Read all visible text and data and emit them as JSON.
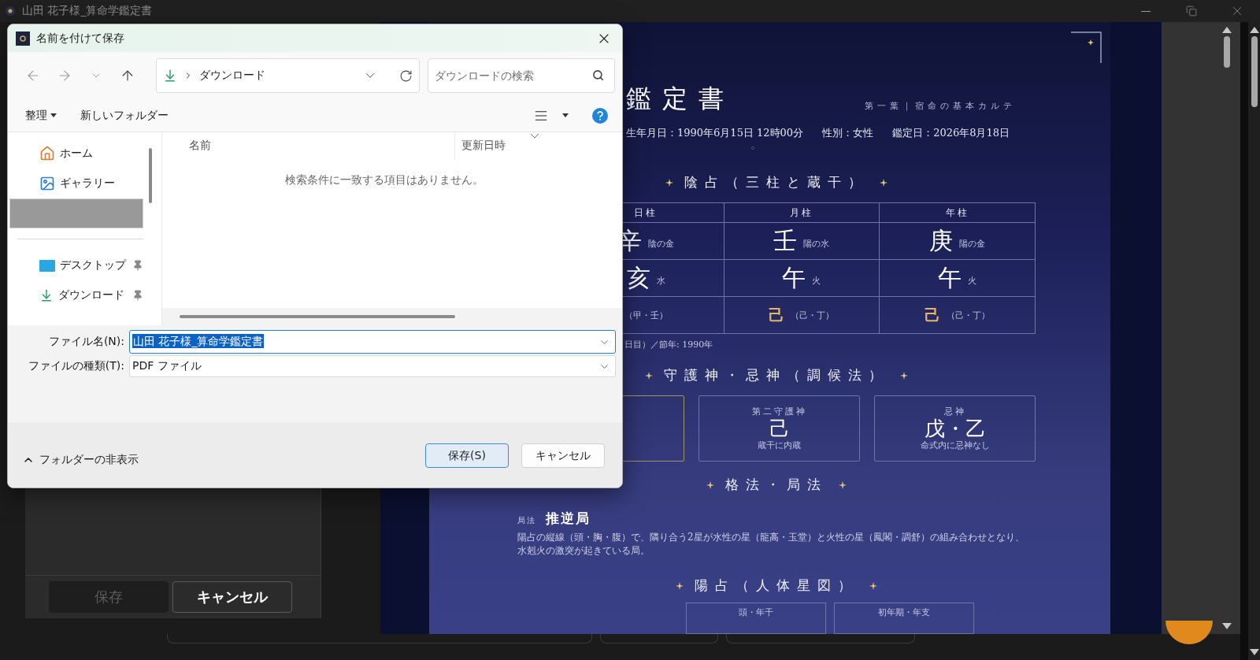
{
  "app": {
    "title": "山田 花子様_算命学鑑定書",
    "panel_buttons": [
      {
        "label": "保存",
        "disabled": true
      },
      {
        "label": "キャンセル",
        "disabled": false
      }
    ]
  },
  "document": {
    "header": {
      "title": "鑑定書",
      "subtitle": "第一葉｜宿命の基本カルテ",
      "info": [
        "生年月日：1990年6月15日 12時00分",
        "性別：女性",
        "鑑定日：2026年8月18日"
      ]
    },
    "insen": {
      "heading": "陰占（三柱と蔵干）",
      "columns": [
        "日柱",
        "月柱",
        "年柱"
      ],
      "rows": [
        {
          "kind": "stem",
          "cells": [
            {
              "char": "辛",
              "note": "陰の金"
            },
            {
              "char": "壬",
              "note": "陽の水"
            },
            {
              "char": "庚",
              "note": "陽の金"
            }
          ]
        },
        {
          "kind": "branch",
          "cells": [
            {
              "char": "亥",
              "note": "水"
            },
            {
              "char": "午",
              "note": "火"
            },
            {
              "char": "午",
              "note": "火"
            }
          ]
        },
        {
          "kind": "hidden",
          "cells": [
            {
              "note": "（甲・壬）"
            },
            {
              "char": "己",
              "note": "（己・丁）"
            },
            {
              "char": "己",
              "note": "（己・丁）"
            }
          ]
        }
      ],
      "note": "日目）／節年: 1990年"
    },
    "guardians": {
      "heading": "守護神・忌神（調候法）",
      "cards": [
        {
          "highlighted": true
        },
        {
          "highlighted": false,
          "label": "第二守護神",
          "value": "己",
          "caption": "蔵干に内蔵"
        },
        {
          "highlighted": false,
          "label": "忌神",
          "value": "戊・乙",
          "caption": "命式内に忌神なし"
        }
      ]
    },
    "kakuho": {
      "heading": "格法・局法",
      "label": "局法",
      "name": "推逆局",
      "text": "陽占の縦線（頭・胸・腹）で、隣り合う2星が水性の星（龍高・玉堂）と火性の星（鳳閣・調舒）の組み合わせとなり、水剋火の激突が起きている局。"
    },
    "yousen": {
      "heading": "陽占（人体星図）",
      "boxes": [
        "頭・年干",
        "初年期・年支"
      ]
    }
  },
  "dialog": {
    "title": "名前を付けて保存",
    "address": "ダウンロード",
    "search": {
      "placeholder": "ダウンロードの検索"
    },
    "toolbar": [
      "整理",
      "新しいフォルダー"
    ],
    "places": [
      {
        "kind": "home",
        "label": "ホーム",
        "selected": false
      },
      {
        "kind": "gallery",
        "label": "ギャラリー",
        "selected": false
      },
      {
        "kind": "blank",
        "selected": true
      }
    ],
    "quick_access": [
      {
        "kind": "desktop",
        "label": "デスクトップ",
        "pinned": true,
        "selected": false
      },
      {
        "kind": "downloads",
        "label": "ダウンロード",
        "pinned": true,
        "selected": false
      }
    ],
    "columns": [
      "名前",
      "更新日時"
    ],
    "empty_message": "検索条件に一致する項目はありません。",
    "file_name": {
      "label": "ファイル名(N):",
      "value": "山田 花子様_算命学鑑定書",
      "text_selected": true
    },
    "file_type": {
      "label": "ファイルの種類(T):",
      "value": "PDF ファイル"
    },
    "toggle_folders": "フォルダーの非表示",
    "buttons": [
      {
        "label": "保存(S)",
        "kind": "primary"
      },
      {
        "label": "キャンセル",
        "kind": "secondary"
      }
    ]
  }
}
